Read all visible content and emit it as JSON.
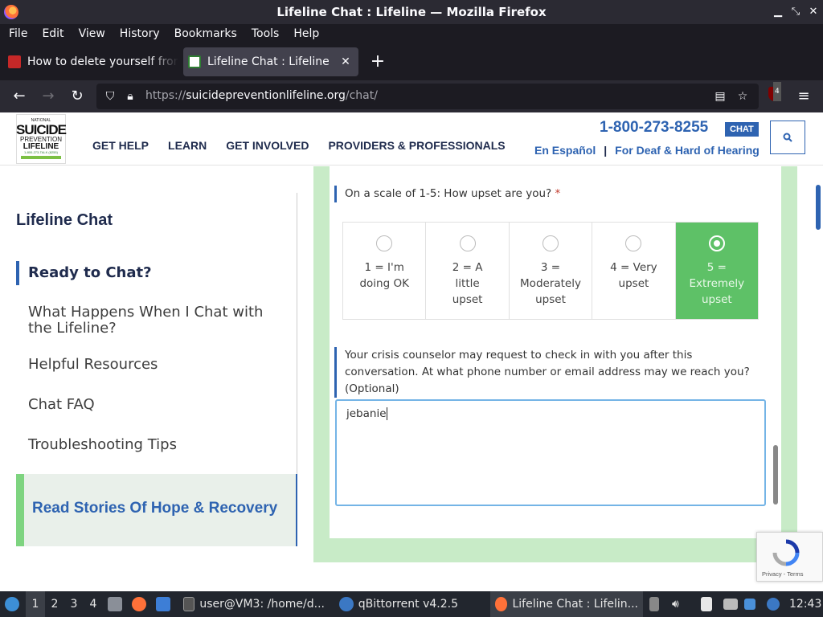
{
  "browser": {
    "window_title": "Lifeline Chat : Lifeline — Mozilla Firefox",
    "menu": [
      "File",
      "Edit",
      "View",
      "History",
      "Bookmarks",
      "Tools",
      "Help"
    ],
    "tabs": [
      {
        "label": "How to delete yourself from",
        "active": false
      },
      {
        "label": "Lifeline Chat : Lifeline",
        "active": true
      }
    ],
    "url_prefix": "https://",
    "url_domain": "suicidepreventionlifeline.org",
    "url_path": "/chat/",
    "extension_badge": "4"
  },
  "site": {
    "logo": {
      "line1": "NATIONAL",
      "line2": "SUICIDE",
      "line3": "PREVENTION",
      "line4": "LIFELINE",
      "line5": "1-800-273-TALK (8255)"
    },
    "nav": [
      "GET HELP",
      "LEARN",
      "GET INVOLVED",
      "PROVIDERS & PROFESSIONALS"
    ],
    "phone": "1-800-273-8255",
    "chat_badge": "CHAT",
    "lang_link": "En Español",
    "separator": "|",
    "deaf_link": "For Deaf & Hard of Hearing"
  },
  "sidebar": {
    "title": "Lifeline Chat",
    "items": [
      {
        "label": "Ready to Chat?",
        "active": true
      },
      {
        "label": "What Happens When I Chat with the Lifeline?",
        "active": false
      },
      {
        "label": "Helpful Resources",
        "active": false
      },
      {
        "label": "Chat FAQ",
        "active": false
      },
      {
        "label": "Troubleshooting Tips",
        "active": false
      }
    ],
    "stories_label": "Read Stories Of Hope & Recovery"
  },
  "form": {
    "upset_question": "On a scale of 1-5: How upset are you?",
    "required_mark": "*",
    "scale_options": [
      {
        "label": "1 = I'm doing OK",
        "selected": false
      },
      {
        "label": "2 = A little upset",
        "selected": false
      },
      {
        "label": "3 = Moderately upset",
        "selected": false
      },
      {
        "label": "4 = Very upset",
        "selected": false
      },
      {
        "label": "5 = Extremely upset",
        "selected": true
      }
    ],
    "contact_question": "Your crisis counselor may request to check in with you after this conversation. At what phone number or email address may we reach you? (Optional)",
    "contact_value": "jebanie"
  },
  "recaptcha": {
    "links": "Privacy - Terms"
  },
  "taskbar": {
    "workspaces": [
      "1",
      "2",
      "3",
      "4"
    ],
    "apps": [
      {
        "label": "user@VM3: /home/d...",
        "active": false
      },
      {
        "label": "qBittorrent v4.2.5",
        "active": false
      },
      {
        "label": "Lifeline Chat : Lifelin...",
        "active": true
      }
    ],
    "clock": "12:43"
  },
  "colors": {
    "accent_blue": "#2e63b1",
    "selected_green": "#5ec167",
    "frame_green": "#c8ebc7"
  }
}
